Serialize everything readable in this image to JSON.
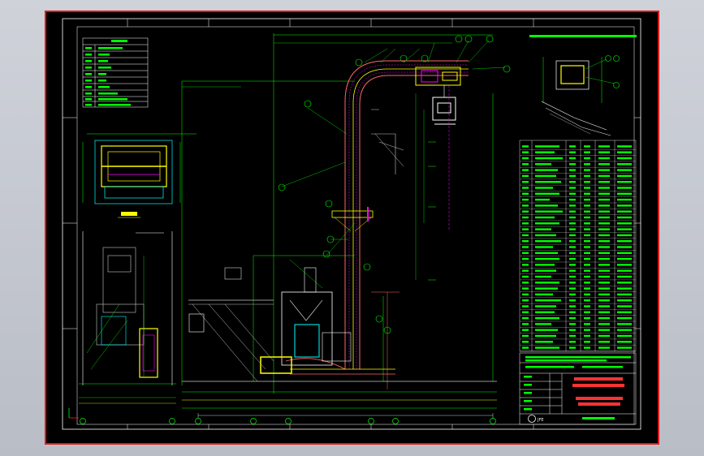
{
  "logo_text": "JFE",
  "colors": {
    "background": "#000000",
    "frame": "#e01818",
    "border": "#ffffff",
    "yellow": "#ffff00",
    "green": "#00ff00",
    "cyan": "#00ffff",
    "magenta": "#ff00ff",
    "red": "#ff2020"
  }
}
